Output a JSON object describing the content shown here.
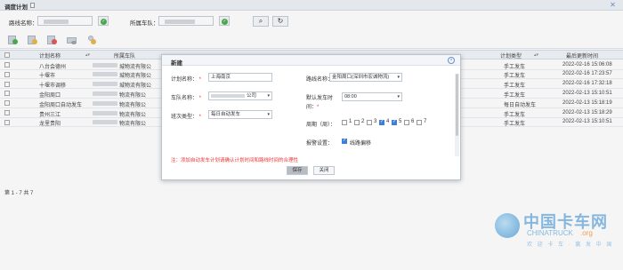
{
  "window": {
    "title": "调度计划"
  },
  "filters": {
    "route_label": "路线名称：",
    "team_label": "所属车队："
  },
  "grid": {
    "headers": [
      "计划名称",
      "所属车队",
      "计划类型",
      "最后更新时间"
    ],
    "rows": [
      {
        "name": "八台会德州",
        "team": "城物流有限公",
        "type": "手工发车",
        "time": "2022-02-16 15:06:08"
      },
      {
        "name": "十堰市",
        "team": "城物流有限公",
        "type": "手工发车",
        "time": "2022-02-16 17:23:57"
      },
      {
        "name": "十堰市调移",
        "team": "城物流有限公",
        "type": "手工发车",
        "time": "2022-02-16 17:32:18"
      },
      {
        "name": "金阳周口",
        "team": "物流有限公",
        "type": "手工发车",
        "time": "2022-02-13 15:10:51"
      },
      {
        "name": "金阳周口自动发车",
        "team": "物流有限公",
        "type": "每日自动发车",
        "time": "2022-02-13 15:18:19"
      },
      {
        "name": "贵州三江",
        "team": "物流有限公",
        "type": "手工发车",
        "time": "2022-02-13 15:18:29"
      },
      {
        "name": "龙里贵阳",
        "team": "物流有限公",
        "type": "手工发车",
        "time": "2022-02-13 15:10:51"
      }
    ]
  },
  "pager": {
    "text": "第 1 - 7 共 7"
  },
  "dialog": {
    "title": "新建",
    "plan_name_label": "计划名称：",
    "plan_name_value": "上海南京",
    "route_label": "路线名称：",
    "route_value": "金阳周口(深圳市宏诚物流)",
    "team_label": "车队名称：",
    "team_value": "公司",
    "depart_time_label": "默认发车时",
    "depart_time_label2": "间：",
    "depart_time_value": "08:00",
    "shift_label": "班次类型：",
    "shift_value": "每日自动发车",
    "cycle_label": "周期（周）：",
    "days": [
      {
        "label": "1",
        "checked": false
      },
      {
        "label": "2",
        "checked": false
      },
      {
        "label": "3",
        "checked": false
      },
      {
        "label": "4",
        "checked": true
      },
      {
        "label": "5",
        "checked": true
      },
      {
        "label": "6",
        "checked": false
      },
      {
        "label": "7",
        "checked": false
      }
    ],
    "alarm_label": "报警设置：",
    "alarm_option": "线路偏移",
    "alarm_checked": true,
    "note": "注：添加自动发车计划请确认计划时间和路线时间的合理性",
    "save_label": "保存",
    "close_label": "关闭"
  },
  "watermark": {
    "cn": "中国卡车网",
    "en": "CHINATRUCK",
    "dot": ".org",
    "slogan": "欢 迎 卡 车 · 赢 发 中 国"
  }
}
